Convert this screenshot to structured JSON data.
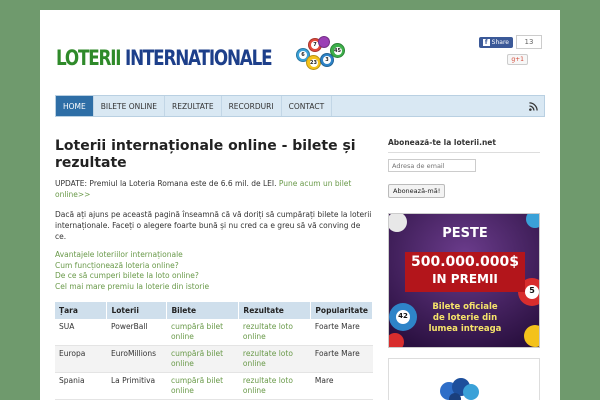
{
  "header": {
    "logo_part1": "LOTERII",
    "logo_part2": "INTERNATIONALE",
    "balls": [
      "6",
      "7",
      "3",
      "23",
      "45"
    ],
    "share_label": "Share",
    "share_count": "13",
    "gplus_label": "g+1"
  },
  "nav": {
    "items": [
      "HOME",
      "BILETE ONLINE",
      "REZULTATE",
      "RECORDURI",
      "CONTACT"
    ]
  },
  "main": {
    "title": "Loterii internaționale online - bilete și rezultate",
    "update_text": "UPDATE: Premiul la Loteria Romana este de 6.6 mil. de LEI.",
    "update_link": "Pune acum un bilet online>>",
    "intro": "Dacă ați ajuns pe această pagină înseamnă că vă doriți să cumpărați bilete la loterii internaționale. Faceți o alegere foarte bună și nu cred ca e greu să vă conving de ce.",
    "links": [
      "Avantajele loteriilor internaționale",
      "Cum funcționează loteria online?",
      "De ce să cumperi bilete la loto online?",
      "Cel mai mare premiu la loterie din istorie"
    ],
    "table": {
      "headers": [
        "Țara",
        "Loterii",
        "Bilete",
        "Rezultate",
        "Popularitate"
      ],
      "rows": [
        [
          "SUA",
          "PowerBall",
          "cumpără bilet online",
          "rezultate loto online",
          "Foarte Mare"
        ],
        [
          "Europa",
          "EuroMillions",
          "cumpără bilet online",
          "rezultate loto online",
          "Foarte Mare"
        ],
        [
          "Spania",
          "La Primitiva",
          "cumpără bilet online",
          "rezultate loto online",
          "Mare"
        ]
      ]
    }
  },
  "sidebar": {
    "title": "Abonează-te la loterii.net",
    "email_placeholder": "Adresa de email",
    "subscribe_label": "Abonează-mă!",
    "banner": {
      "line1": "PESTE",
      "line2": "500.000.000$",
      "line3": "IN PREMII",
      "line4": "Bilete oficiale",
      "line5": "de loterie din",
      "line6": "lumea intreaga",
      "balls": [
        "5",
        "42"
      ]
    }
  },
  "colors": {
    "background": "#6f9a6d",
    "nav_active": "#2e6ea6",
    "link": "#6a9a4a",
    "banner_red": "#b3151b",
    "banner_purple": "#3a1a58"
  }
}
